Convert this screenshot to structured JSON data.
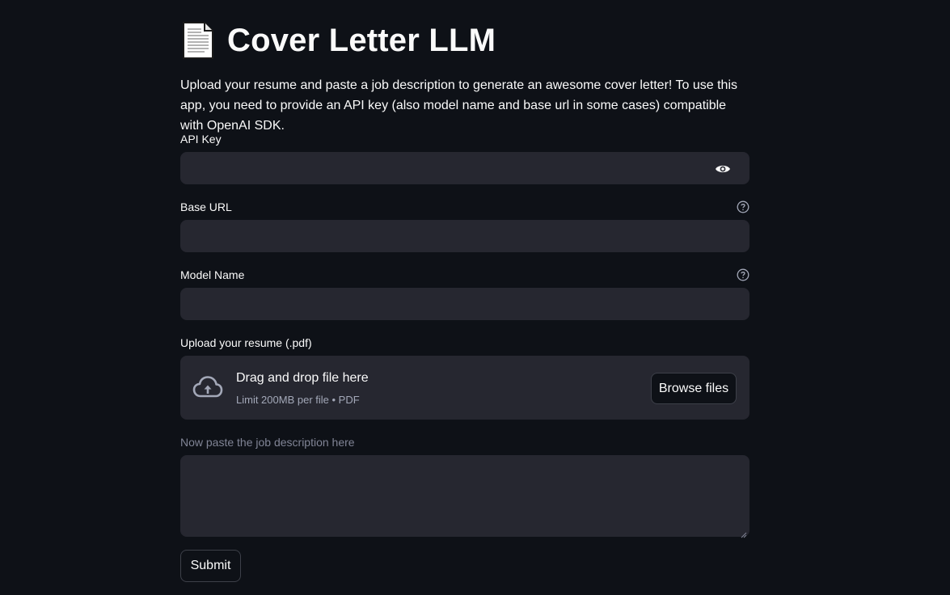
{
  "header": {
    "title": "Cover Letter LLM",
    "icon": "page-facing-up-icon",
    "intro": "Upload your resume and paste a job description to generate an awesome cover letter! To use this app, you need to provide an API key (also model name and base url in some cases) compatible with OpenAI SDK."
  },
  "form": {
    "api_key": {
      "label": "API Key",
      "value": ""
    },
    "base_url": {
      "label": "Base URL",
      "value": ""
    },
    "model_name": {
      "label": "Model Name",
      "value": ""
    },
    "resume": {
      "label": "Upload your resume (.pdf)",
      "drag_text": "Drag and drop file here",
      "limit_text": "Limit 200MB per file • PDF",
      "browse_label": "Browse files"
    },
    "job_description": {
      "label": "Now paste the job description here",
      "value": ""
    },
    "submit_label": "Submit"
  },
  "colors": {
    "background": "#0e1117",
    "input_bg": "#262730",
    "text": "#fafafa",
    "muted": "#808495"
  }
}
